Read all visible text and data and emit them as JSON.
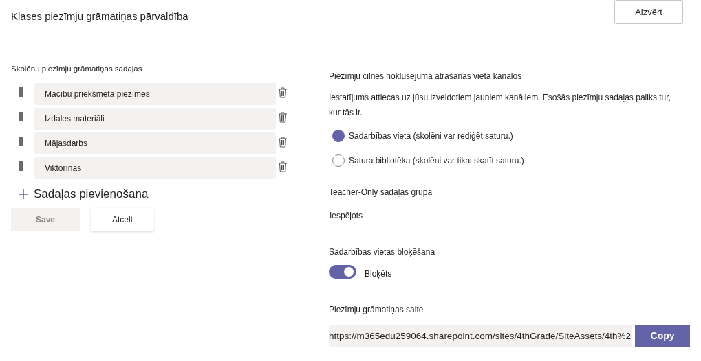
{
  "header": {
    "title": "Klases piezīmju grāmatiņas pārvaldība",
    "close_button": "Aizvērt"
  },
  "sections": {
    "label": "Skolēnu piezīmju grāmatiņas sadaļas",
    "items": [
      {
        "name": "Mācību priekšmeta piezīmes"
      },
      {
        "name": "Izdales materiāli"
      },
      {
        "name": "Mājasdarbs"
      },
      {
        "name": "Viktorīnas"
      }
    ],
    "add_label": "Sadaļas pievienošana",
    "buttons": [
      {
        "label": "Save",
        "disabled": true
      },
      {
        "label": "Atcelt",
        "disabled": false
      }
    ]
  },
  "settings": {
    "default_location": {
      "heading": "Piezīmju cilnes noklusējuma atrašanās vieta kanālos",
      "description": "Iestatījums attiecas uz jūsu izveidotiem jauniem kanāliem. Esošās piezīmju sadaļas paliks tur, kur tās ir.",
      "options": [
        {
          "label": "Sadarbības vieta (skolēni var rediģēt saturu.)",
          "selected": true
        },
        {
          "label": "Satura bibliotēka (skolēni var tikai skatīt saturu.)",
          "selected": false
        }
      ]
    },
    "teacher_only": {
      "heading": "Teacher-Only sadaļas grupa",
      "value": "Iespējots"
    },
    "lock": {
      "heading": "Sadarbības vietas bloķēšana",
      "on": true,
      "label": "Bloķēts"
    },
    "link": {
      "heading": "Piezīmju grāmatiņas saite",
      "url": "https://m365edu259064.sharepoint.com/sites/4thGrade/SiteAssets/4th%2",
      "copy_button": "Copy"
    }
  }
}
